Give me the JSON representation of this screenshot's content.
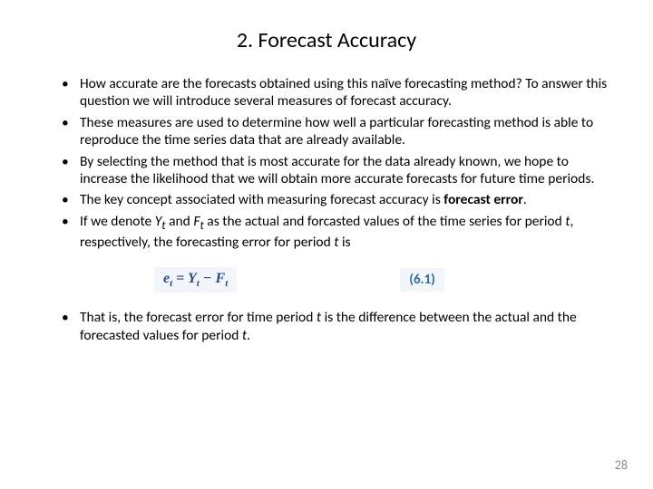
{
  "title": "2. Forecast Accuracy",
  "bullets_top": [
    "How accurate are the forecasts obtained using this naïve forecasting method? To answer this question we will introduce several measures of forecast accuracy.",
    "These measures are used to determine how well a particular forecasting method is able to reproduce the time series data that are already available.",
    "By selecting the method that is most accurate for the data already known, we hope to increase the likelihood that we will obtain more accurate forecasts for future time periods."
  ],
  "bullet4_prefix": "The key concept associated with measuring forecast accuracy is ",
  "bullet4_bold": "forecast error",
  "bullet4_suffix": ".",
  "bullet5_a": "If we denote ",
  "bullet5_Y": "Y",
  "bullet5_sub": "t",
  "bullet5_b": " and ",
  "bullet5_F": "F",
  "bullet5_c": " as the actual and forcasted values of the time series for period ",
  "bullet5_t": "t",
  "bullet5_d": ", respectively, the forecasting error for period ",
  "bullet5_e": " is",
  "eq_lhs": "e",
  "eq_eq": " = ",
  "eq_Y": "Y",
  "eq_minus": " − ",
  "eq_F": "F",
  "eq_num": "(6.1)",
  "bullet6_a": "That is, the forecast error for time period ",
  "bullet6_t": "t",
  "bullet6_b": " is the difference between the actual and the forecasted values for period ",
  "bullet6_c": ".",
  "page": "28"
}
